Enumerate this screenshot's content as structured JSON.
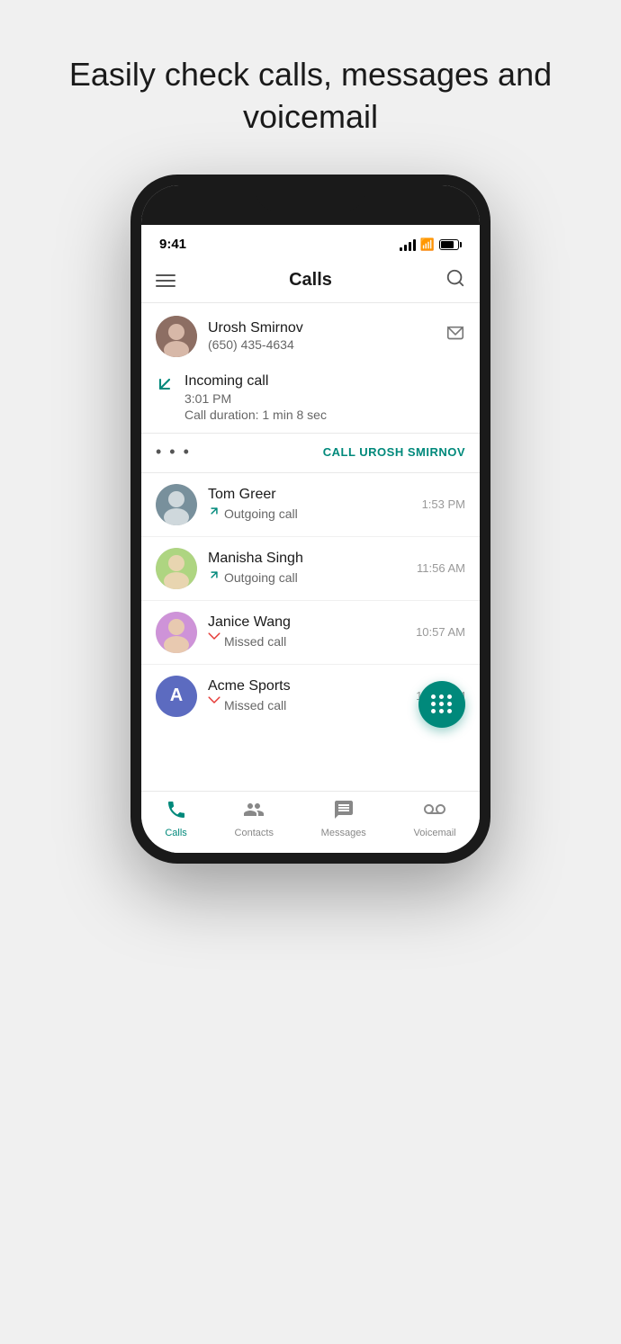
{
  "page": {
    "header": "Easily check calls, messages and voicemail"
  },
  "status_bar": {
    "time": "9:41"
  },
  "app": {
    "title": "Calls",
    "menu_icon": "menu-icon",
    "search_icon": "search-icon"
  },
  "expanded_contact": {
    "name": "Urosh Smirnov",
    "phone": "(650) 435-4634",
    "call_type": "Incoming call",
    "call_time": "3:01 PM",
    "call_duration": "Call duration: 1 min 8 sec",
    "call_action": "CALL UROSH SMIRNOV"
  },
  "call_list": [
    {
      "name": "Tom Greer",
      "type": "Outgoing call",
      "time": "1:53 PM",
      "arrow": "outgoing"
    },
    {
      "name": "Manisha Singh",
      "type": "Outgoing call",
      "time": "11:56 AM",
      "arrow": "outgoing"
    },
    {
      "name": "Janice Wang",
      "type": "Missed call",
      "time": "10:57 AM",
      "arrow": "missed"
    },
    {
      "name": "Acme Sports",
      "type": "Missed call",
      "time": "10:42 AM",
      "arrow": "missed"
    }
  ],
  "bottom_nav": [
    {
      "label": "Calls",
      "active": true
    },
    {
      "label": "Contacts",
      "active": false
    },
    {
      "label": "Messages",
      "active": false
    },
    {
      "label": "Voicemail",
      "active": false
    }
  ]
}
